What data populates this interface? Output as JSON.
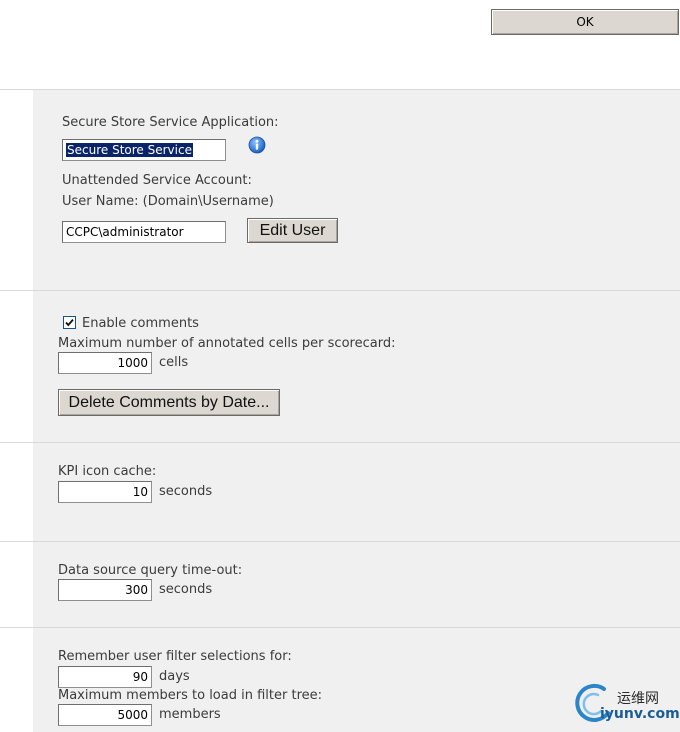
{
  "toolbar": {
    "ok_label": "OK"
  },
  "secure_store": {
    "app_label": "Secure Store Service Application:",
    "app_value": "Secure Store Service",
    "account_label": "Unattended Service Account:",
    "username_label": "User Name: (Domain\\Username)",
    "username_value": "CCPC\\administrator",
    "edit_user_label": "Edit User"
  },
  "comments": {
    "enable_label": "Enable comments",
    "enabled": true,
    "max_label": "Maximum number of annotated cells per scorecard:",
    "max_value": "1000",
    "max_unit": "cells",
    "delete_label": "Delete Comments by Date..."
  },
  "kpi_cache": {
    "label": "KPI icon cache:",
    "value": "10",
    "unit": "seconds"
  },
  "query_timeout": {
    "label": "Data source query time-out:",
    "value": "300",
    "unit": "seconds"
  },
  "filters": {
    "remember_label": "Remember user filter selections for:",
    "remember_value": "90",
    "remember_unit": "days",
    "max_members_label": "Maximum members to load in filter tree:",
    "max_members_value": "5000",
    "max_members_unit": "members"
  },
  "watermark": {
    "line1": "运维网",
    "line2": "iyunv.com"
  },
  "colors": {
    "panel_bg": "#f0f0f0",
    "selection": "#0a246a",
    "info_blue": "#1f6fd1"
  }
}
